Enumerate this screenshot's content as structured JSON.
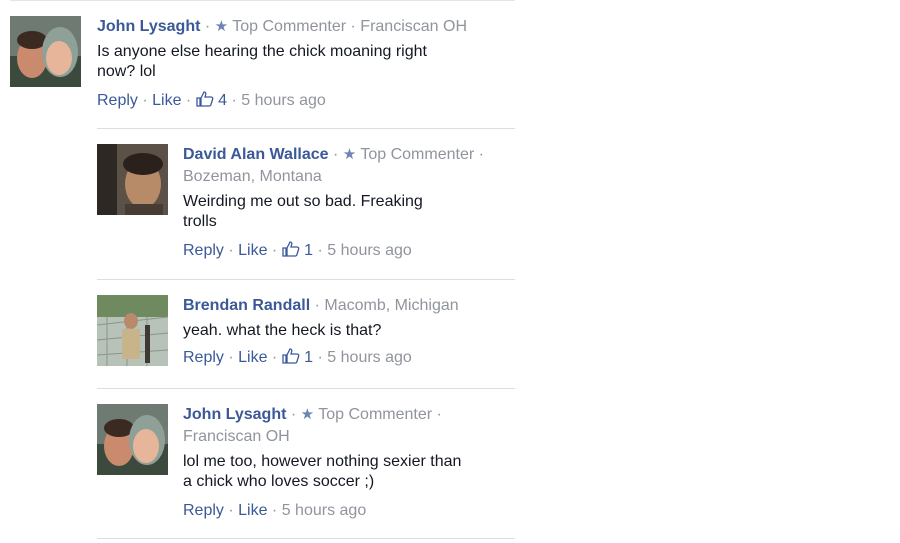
{
  "comments": [
    {
      "name": "John Lysaght",
      "badge": "Top Commenter",
      "location": "Franciscan OH",
      "text": "Is anyone else hearing the chick moaning right now? lol",
      "reply": "Reply",
      "like": "Like",
      "likes": "4",
      "time": "5 hours ago"
    },
    {
      "name": "David Alan Wallace",
      "badge": "Top Commenter",
      "location": "Bozeman, Montana",
      "text": "Weirding me out so bad. Freaking trolls",
      "reply": "Reply",
      "like": "Like",
      "likes": "1",
      "time": "5 hours ago"
    },
    {
      "name": "Brendan Randall",
      "location": "Macomb, Michigan",
      "text": "yeah. what the heck is that?",
      "reply": "Reply",
      "like": "Like",
      "likes": "1",
      "time": "5 hours ago"
    },
    {
      "name": "John Lysaght",
      "badge": "Top Commenter",
      "location": "Franciscan OH",
      "text": "lol me too, however nothing sexier than a chick who loves soccer ;)",
      "reply": "Reply",
      "like": "Like",
      "time": "5 hours ago"
    }
  ],
  "colors": {
    "link": "#3b5998",
    "meta": "#90949c",
    "text": "#141823"
  },
  "icons": {
    "badge": "star-icon",
    "likes": "thumbs-up-icon"
  }
}
